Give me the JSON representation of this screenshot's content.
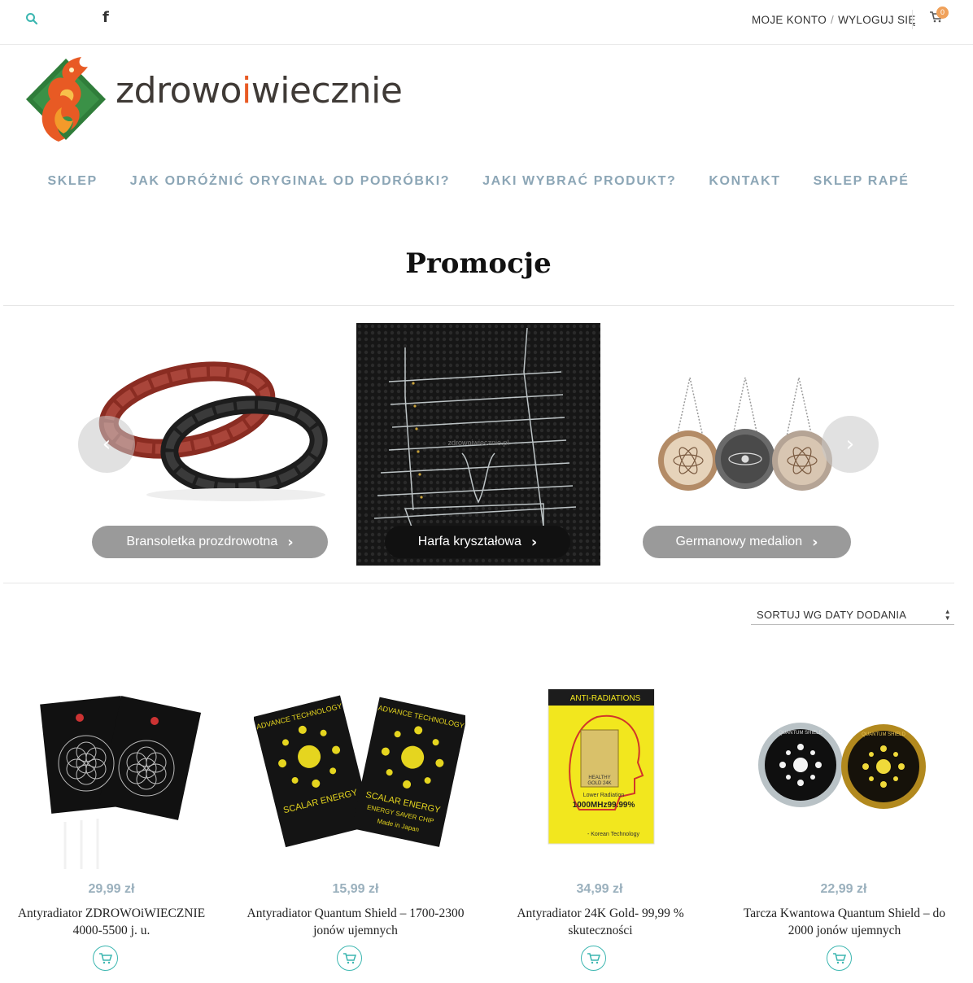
{
  "topbar": {
    "account_label": "MOJE KONTO",
    "separator": "/",
    "logout_label": "WYLOGUJ SIĘ",
    "cart_count": "0",
    "facebook_glyph": "f"
  },
  "logo": {
    "text_before": "zdrowo",
    "text_accent": "i",
    "text_after": "wiecznie",
    "colors": {
      "green": "#2f7d3a",
      "orange": "#e85a24"
    }
  },
  "nav": {
    "items": [
      "SKLEP",
      "JAK ODRÓŻNIĆ ORYGINAŁ OD PODRÓBKI?",
      "JAKI WYBRAĆ PRODUKT?",
      "KONTAKT",
      "SKLEP RAPÉ"
    ]
  },
  "page": {
    "title": "Promocje"
  },
  "slider": {
    "prev_glyph": "‹",
    "next_glyph": "›",
    "slides": [
      {
        "label": "Bransoletka prozdrowotna",
        "chevron": "›"
      },
      {
        "label": "Harfa kryształowa",
        "chevron": "›",
        "watermark": "zdrowoiwiecznie.pl"
      },
      {
        "label": "Germanowy medalion",
        "chevron": "›"
      }
    ]
  },
  "sort": {
    "selected": "SORTUJ WG DATY DODANIA",
    "up": "▲",
    "down": "▼"
  },
  "products": [
    {
      "price": "29,99 zł",
      "name": "Antyradiator ZDROWOiWIECZNIE 4000-5500 j. u."
    },
    {
      "price": "15,99 zł",
      "name": "Antyradiator Quantum Shield – 1700-2300 jonów ujemnych",
      "card_text_1": "ADVANCE TECHNOLOGY",
      "card_text_2": "SCALAR ENERGY",
      "card_text_3": "ENERGY SAVER CHIP",
      "card_text_4": "Made in Japan"
    },
    {
      "price": "34,99 zł",
      "name": "Antyradiator 24K Gold- 99,99 % skuteczności",
      "card_title": "ANTI-RADIATIONS",
      "card_healthy": "HEALTHY",
      "card_gold": "GOLD 24K",
      "card_lower": "Lower Radiation",
      "card_freq": "1000MHz99.99%",
      "card_korean": "- Korean Technology"
    },
    {
      "price": "22,99 zł",
      "name": "Tarcza Kwantowa Quantum Shield – do 2000 jonów ujemnych",
      "coin_text": "QUANTUM SHIELD"
    }
  ],
  "colors": {
    "nav": "#8ca6b6",
    "price": "#9ab0bd",
    "teal": "#3bb6b0",
    "badge": "#f0a15a"
  }
}
